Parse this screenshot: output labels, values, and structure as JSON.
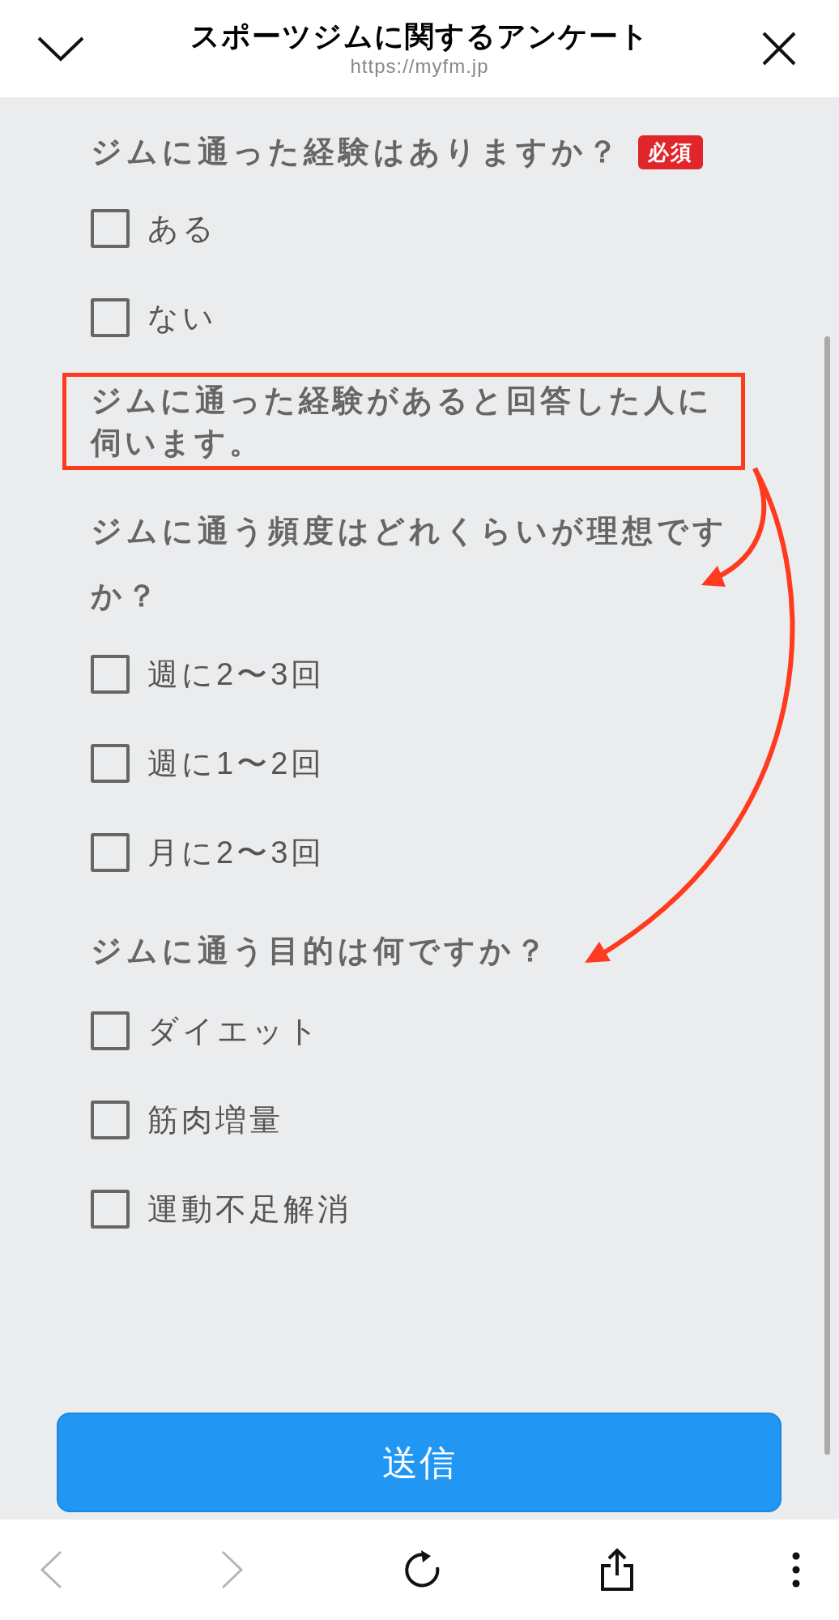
{
  "header": {
    "title": "スポーツジムに関するアンケート",
    "url": "https://myfm.jp"
  },
  "sections": [
    {
      "kind": "question",
      "label": "ジムに通った経験はありますか？",
      "badge": "必須",
      "options": [
        {
          "label": "ある",
          "checked": false
        },
        {
          "label": "ない",
          "checked": false
        }
      ]
    },
    {
      "kind": "note",
      "label": "ジムに通った経験があると回答した人に伺います。"
    },
    {
      "kind": "question",
      "label": "ジムに通う頻度はどれくらいが理想ですか？",
      "options": [
        {
          "label": "週に2〜3回",
          "checked": false
        },
        {
          "label": "週に1〜2回",
          "checked": false
        },
        {
          "label": "月に2〜3回",
          "checked": false
        }
      ]
    },
    {
      "kind": "question",
      "label": "ジムに通う目的は何ですか？",
      "options": [
        {
          "label": "ダイエット",
          "checked": false
        },
        {
          "label": "筋肉増量",
          "checked": false
        },
        {
          "label": "運動不足解消",
          "checked": false
        }
      ]
    }
  ],
  "submit": "送信",
  "toolbar": [
    {
      "kind": "back",
      "disabled": true
    },
    {
      "kind": "forward",
      "disabled": true
    },
    {
      "kind": "reload",
      "disabled": false
    },
    {
      "kind": "share",
      "disabled": false
    },
    {
      "kind": "more",
      "disabled": false
    }
  ]
}
